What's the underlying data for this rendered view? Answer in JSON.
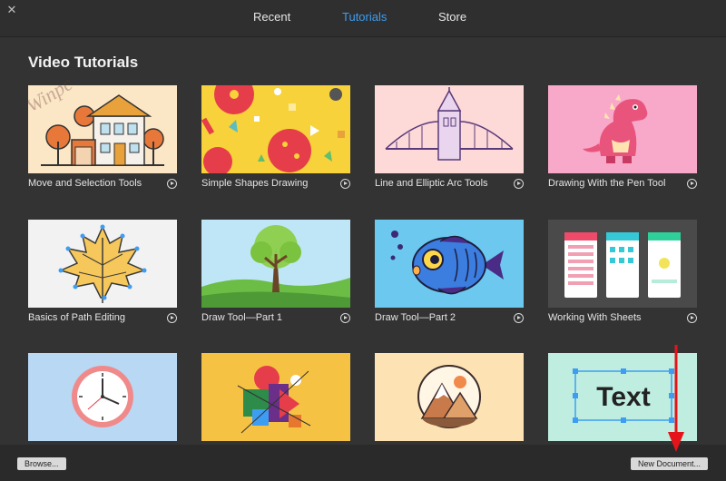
{
  "tabs": [
    "Recent",
    "Tutorials",
    "Store"
  ],
  "active_tab": "Tutorials",
  "section_title": "Video Tutorials",
  "cards": [
    {
      "label": "Move and Selection Tools"
    },
    {
      "label": "Simple Shapes Drawing"
    },
    {
      "label": "Line and Elliptic Arc Tools"
    },
    {
      "label": "Drawing With the Pen Tool"
    },
    {
      "label": "Basics of Path Editing"
    },
    {
      "label": "Draw Tool—Part 1"
    },
    {
      "label": "Draw Tool—Part 2"
    },
    {
      "label": "Working With Sheets"
    },
    {
      "label": ""
    },
    {
      "label": ""
    },
    {
      "label": ""
    },
    {
      "label": ""
    }
  ],
  "text_thumb_word": "Text",
  "buttons": {
    "browse": "Browse...",
    "new_document": "New Document..."
  },
  "colors": {
    "accent": "#3d9df3",
    "arrow": "#e5141b"
  },
  "icons": {
    "close": "close-icon",
    "play": "play-icon"
  }
}
